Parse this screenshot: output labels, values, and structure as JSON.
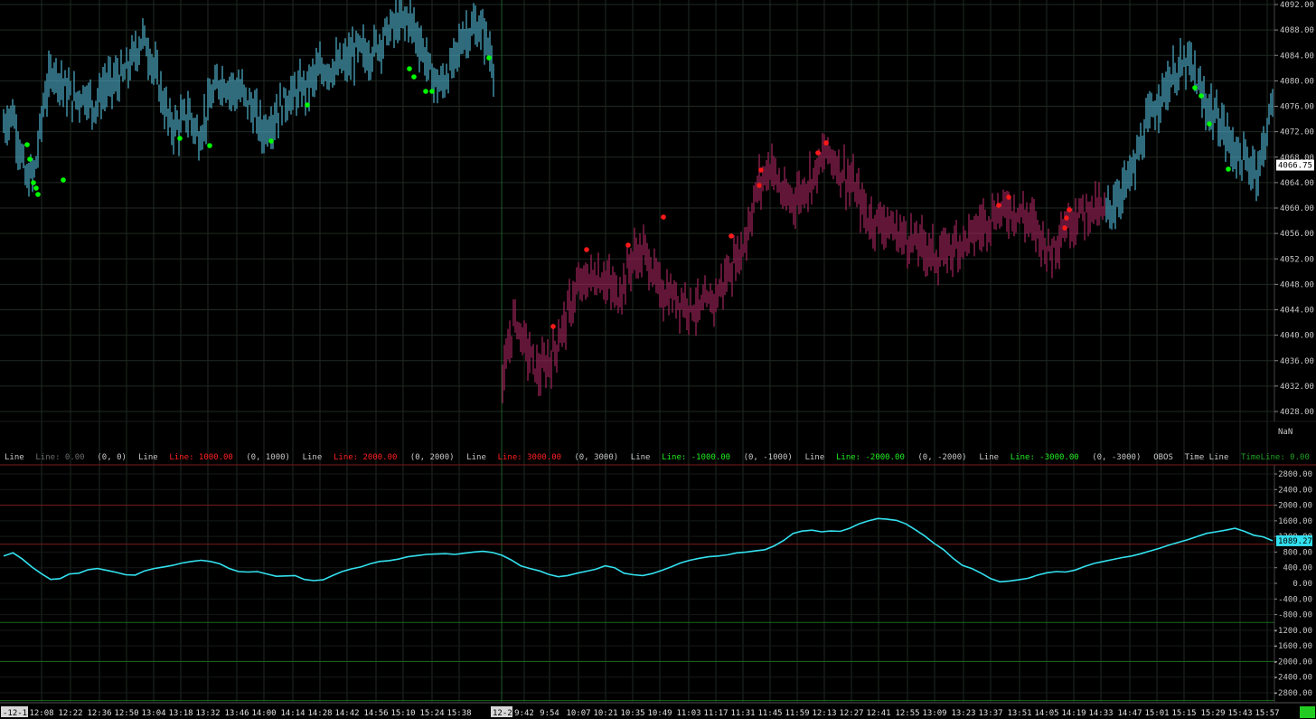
{
  "colors": {
    "background": "#000000",
    "grid": "#1f2a22",
    "bull_bar": "#4fb3cf",
    "bear_bar": "#a3245c",
    "bull_dot": "#00ff00",
    "bear_dot": "#ff1a1a",
    "oscillator": "#33e0ee",
    "upper_line": "#7a1a1a",
    "lower_line": "#1a6a1a",
    "session_divider": "#1f5a2a",
    "price_box": "#ffffff",
    "osc_box": "#33e0ee",
    "status_box": "#22cc22"
  },
  "price_axis": {
    "ticks": [
      "4092.00",
      "4088.00",
      "4084.00",
      "4080.00",
      "4076.00",
      "4072.00",
      "4068.00",
      "4064.00",
      "4060.00",
      "4056.00",
      "4052.00",
      "4048.00",
      "4044.00",
      "4040.00",
      "4036.00",
      "4032.00",
      "4028.00"
    ],
    "current_label": "4066.75"
  },
  "oscillator_axis": {
    "ticks": [
      "2800.00",
      "2400.00",
      "2000.00",
      "1600.00",
      "1200.00",
      "800.00",
      "400.00",
      "0.00",
      "-400.00",
      "-800.00",
      "-1200.00",
      "-1600.00",
      "-2000.00",
      "-2400.00",
      "-2800.00"
    ],
    "nan_label": "NaN",
    "current_label": "1089.27"
  },
  "legend": [
    {
      "text": "Line",
      "color": "#c8c8c8"
    },
    {
      "text": "Line: 0.00",
      "color": "#6b6b6b"
    },
    {
      "text": "(0, 0)",
      "color": "#c8c8c8"
    },
    {
      "text": "Line",
      "color": "#c8c8c8"
    },
    {
      "text": "Line: 1000.00",
      "color": "#ff2020"
    },
    {
      "text": "(0, 1000)",
      "color": "#c8c8c8"
    },
    {
      "text": "Line",
      "color": "#c8c8c8"
    },
    {
      "text": "Line: 2000.00",
      "color": "#ff2020"
    },
    {
      "text": "(0, 2000)",
      "color": "#c8c8c8"
    },
    {
      "text": "Line",
      "color": "#c8c8c8"
    },
    {
      "text": "Line: 3000.00",
      "color": "#ff2020"
    },
    {
      "text": "(0, 3000)",
      "color": "#c8c8c8"
    },
    {
      "text": "Line",
      "color": "#c8c8c8"
    },
    {
      "text": "Line: -1000.00",
      "color": "#20ee20"
    },
    {
      "text": "(0, -1000)",
      "color": "#c8c8c8"
    },
    {
      "text": "Line",
      "color": "#c8c8c8"
    },
    {
      "text": "Line: -2000.00",
      "color": "#20ee20"
    },
    {
      "text": "(0, -2000)",
      "color": "#c8c8c8"
    },
    {
      "text": "Line",
      "color": "#c8c8c8"
    },
    {
      "text": "Line: -3000.00",
      "color": "#20ee20"
    },
    {
      "text": "(0, -3000)",
      "color": "#c8c8c8"
    },
    {
      "text": "OBOS",
      "color": "#c8c8c8"
    },
    {
      "text": "Time Line",
      "color": "#c8c8c8"
    },
    {
      "text": "TimeLine: 0.00",
      "color": "#20a020"
    },
    {
      "text": "TimeLine: 0",
      "color": "#c8c8c8"
    }
  ],
  "time_axis": {
    "date_label_1": "-12-1",
    "labels_1": [
      "12:08",
      "12:22",
      "12:36",
      "12:50",
      "13:04",
      "13:18",
      "13:32",
      "13:46",
      "14:00",
      "14:14",
      "14:28",
      "14:42",
      "14:56",
      "15:10",
      "15:24",
      "15:38"
    ],
    "date_label_2": "12-2",
    "labels_2": [
      "9:42",
      "9:54",
      "10:07",
      "10:21",
      "10:35",
      "10:49",
      "11:03",
      "11:17",
      "11:31",
      "11:45",
      "11:59",
      "12:13",
      "12:27",
      "12:41",
      "12:55",
      "13:09",
      "13:23",
      "13:37",
      "13:51",
      "14:05",
      "14:19",
      "14:33",
      "14:47",
      "15:01",
      "15:15",
      "15:29",
      "15:43",
      "15:57"
    ]
  },
  "chart_data": [
    {
      "type": "bar",
      "subtype": "ohlc-price",
      "y_axis": "price",
      "ylim": [
        4026,
        4093
      ],
      "grid": true,
      "sessions": [
        {
          "date": "-12-1",
          "time_range": [
            "12:08",
            "15:38"
          ],
          "approx_close_path": [
            [
              "12:00",
              4073
            ],
            [
              "12:04",
              4075
            ],
            [
              "12:07",
              4070
            ],
            [
              "12:10",
              4064
            ],
            [
              "12:14",
              4066
            ],
            [
              "12:18",
              4077
            ],
            [
              "12:22",
              4082
            ],
            [
              "12:27",
              4079
            ],
            [
              "12:31",
              4077
            ],
            [
              "12:36",
              4078
            ],
            [
              "12:40",
              4076
            ],
            [
              "12:45",
              4079
            ],
            [
              "12:50",
              4080
            ],
            [
              "12:54",
              4081
            ],
            [
              "12:58",
              4084
            ],
            [
              "13:02",
              4087
            ],
            [
              "13:06",
              4083
            ],
            [
              "13:10",
              4078
            ],
            [
              "13:14",
              4073
            ],
            [
              "13:18",
              4073
            ],
            [
              "13:22",
              4075
            ],
            [
              "13:27",
              4071
            ],
            [
              "13:32",
              4077
            ],
            [
              "13:36",
              4080
            ],
            [
              "13:41",
              4079
            ],
            [
              "13:46",
              4078
            ],
            [
              "13:50",
              4076
            ],
            [
              "13:55",
              4072
            ],
            [
              "14:00",
              4074
            ],
            [
              "14:05",
              4077
            ],
            [
              "14:10",
              4078
            ],
            [
              "14:14",
              4079
            ],
            [
              "14:19",
              4081
            ],
            [
              "14:23",
              4082
            ],
            [
              "14:28",
              4082
            ],
            [
              "14:33",
              4083
            ],
            [
              "14:37",
              4085
            ],
            [
              "14:42",
              4084
            ],
            [
              "14:47",
              4086
            ],
            [
              "14:51",
              4088
            ],
            [
              "14:56",
              4089
            ],
            [
              "15:00",
              4090
            ],
            [
              "15:05",
              4086
            ],
            [
              "15:10",
              4081
            ],
            [
              "15:14",
              4079
            ],
            [
              "15:19",
              4082
            ],
            [
              "15:24",
              4087
            ],
            [
              "15:28",
              4088
            ],
            [
              "15:33",
              4088
            ],
            [
              "15:38",
              4082
            ]
          ],
          "high": 4092.0,
          "low": 4062.5
        },
        {
          "date": "12-2",
          "time_range": [
            "9:42",
            "15:57"
          ],
          "approx_close_path": [
            [
              "9:30",
              4032
            ],
            [
              "9:36",
              4043
            ],
            [
              "9:42",
              4038
            ],
            [
              "9:48",
              4034
            ],
            [
              "9:54",
              4036
            ],
            [
              "10:00",
              4041
            ],
            [
              "10:07",
              4047
            ],
            [
              "10:14",
              4049
            ],
            [
              "10:21",
              4049
            ],
            [
              "10:28",
              4046
            ],
            [
              "10:35",
              4052
            ],
            [
              "10:42",
              4053
            ],
            [
              "10:49",
              4047
            ],
            [
              "10:56",
              4046
            ],
            [
              "11:03",
              4045
            ],
            [
              "11:10",
              4044
            ],
            [
              "11:17",
              4046
            ],
            [
              "11:24",
              4050
            ],
            [
              "11:31",
              4054
            ],
            [
              "11:38",
              4063
            ],
            [
              "11:45",
              4067
            ],
            [
              "11:52",
              4061
            ],
            [
              "11:59",
              4062
            ],
            [
              "12:06",
              4065
            ],
            [
              "12:13",
              4069
            ],
            [
              "12:20",
              4066
            ],
            [
              "12:27",
              4063
            ],
            [
              "12:34",
              4058
            ],
            [
              "12:41",
              4058
            ],
            [
              "12:48",
              4056
            ],
            [
              "12:55",
              4055
            ],
            [
              "13:02",
              4054
            ],
            [
              "13:09",
              4052
            ],
            [
              "13:16",
              4054
            ],
            [
              "13:23",
              4055
            ],
            [
              "13:30",
              4057
            ],
            [
              "13:37",
              4059
            ],
            [
              "13:44",
              4060
            ],
            [
              "13:51",
              4059
            ],
            [
              "13:58",
              4057
            ],
            [
              "14:05",
              4053
            ],
            [
              "14:12",
              4057
            ],
            [
              "14:19",
              4059
            ],
            [
              "14:26",
              4060
            ],
            [
              "14:33",
              4059
            ],
            [
              "14:40",
              4062
            ],
            [
              "14:47",
              4066
            ],
            [
              "14:54",
              4073
            ],
            [
              "15:01",
              4078
            ],
            [
              "15:08",
              4081
            ],
            [
              "15:15",
              4083
            ],
            [
              "15:22",
              4077
            ],
            [
              "15:29",
              4074
            ],
            [
              "15:36",
              4070
            ],
            [
              "15:43",
              4067
            ],
            [
              "15:50",
              4066
            ],
            [
              "15:57",
              4077
            ]
          ],
          "high": 4085.5,
          "low": 4028.0
        }
      ],
      "last_price": 4066.75
    },
    {
      "type": "line",
      "subtype": "oscillator",
      "y_axis": "oscillator",
      "ylim": [
        -2900,
        2900
      ],
      "reference_lines": [
        {
          "value": 2000,
          "color": "red"
        },
        {
          "value": 1000,
          "color": "red"
        },
        {
          "value": -1000,
          "color": "green"
        },
        {
          "value": -2000,
          "color": "green"
        },
        {
          "value": -3000,
          "color": "green"
        }
      ],
      "values": [
        700,
        780,
        620,
        420,
        250,
        100,
        120,
        240,
        260,
        350,
        380,
        330,
        280,
        220,
        210,
        320,
        380,
        420,
        460,
        520,
        560,
        590,
        560,
        500,
        380,
        300,
        290,
        300,
        240,
        180,
        190,
        200,
        100,
        70,
        90,
        200,
        300,
        370,
        420,
        500,
        560,
        580,
        620,
        680,
        710,
        740,
        750,
        760,
        740,
        770,
        800,
        820,
        790,
        720,
        600,
        450,
        380,
        320,
        230,
        170,
        200,
        260,
        310,
        360,
        450,
        400,
        260,
        220,
        200,
        250,
        330,
        420,
        520,
        590,
        640,
        680,
        700,
        730,
        780,
        800,
        830,
        860,
        960,
        1100,
        1280,
        1340,
        1360,
        1320,
        1340,
        1330,
        1410,
        1520,
        1600,
        1660,
        1640,
        1610,
        1520,
        1370,
        1210,
        1020,
        860,
        640,
        460,
        380,
        260,
        120,
        40,
        60,
        90,
        130,
        210,
        270,
        300,
        290,
        340,
        430,
        510,
        560,
        610,
        660,
        700,
        760,
        830,
        900,
        980,
        1050,
        1120,
        1200,
        1280,
        1320,
        1360,
        1410,
        1330,
        1230,
        1190,
        1089
      ],
      "last_value": 1089.27
    }
  ]
}
